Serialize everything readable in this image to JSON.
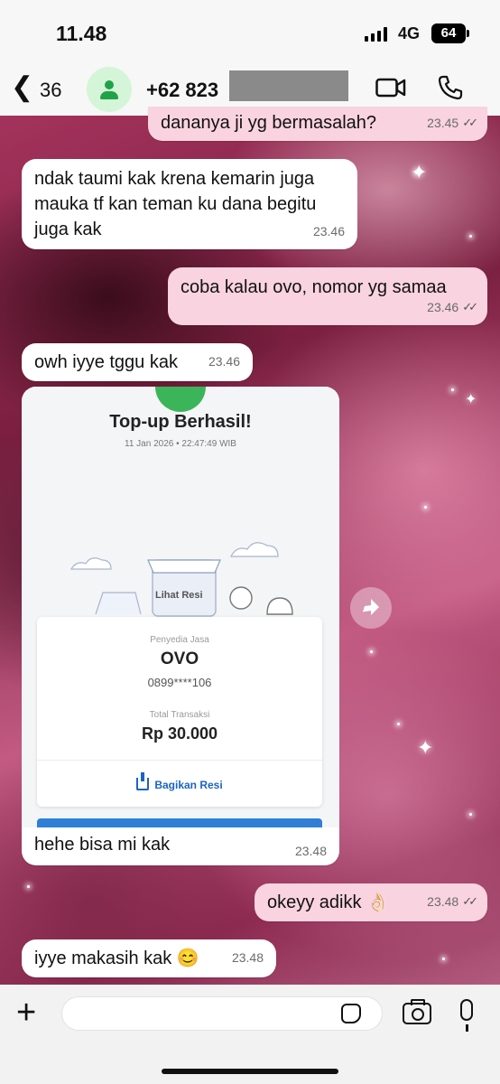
{
  "status_bar": {
    "time": "11.48",
    "network": "4G",
    "battery": "64"
  },
  "header": {
    "back_count": "36",
    "contact": "+62 823",
    "icons": [
      "back-icon",
      "avatar-icon",
      "video-call-icon",
      "voice-call-icon"
    ]
  },
  "messages": [
    {
      "dir": "out",
      "text": "dananya ji yg bermasalah?",
      "time": "23.45",
      "read": true
    },
    {
      "dir": "in",
      "text": "ndak taumi kak krena kemarin juga mauka tf kan teman ku dana begitu juga kak",
      "time": "23.46"
    },
    {
      "dir": "out",
      "text": "coba kalau ovo, nomor yg samaa",
      "time": "23.46",
      "read": true
    },
    {
      "dir": "in",
      "text": "owh iyye tggu kak",
      "time": "23.46"
    },
    {
      "dir": "in",
      "text": "hehe bisa mi kak",
      "time": "23.48"
    },
    {
      "dir": "out",
      "text": "okeyy adikk 👌🏻",
      "time": "23.48",
      "read": true
    },
    {
      "dir": "in",
      "text": "iyye makasih kak 😊",
      "time": "23.48"
    }
  ],
  "receipt": {
    "title": "Top-up Berhasil!",
    "datetime": "11 Jan 2026 • 22:47:49 WIB",
    "view_receipt": "Lihat Resi",
    "provider_label": "Penyedia Jasa",
    "provider": "OVO",
    "number": "0899****106",
    "total_label": "Total Transaksi",
    "amount": "Rp 30.000",
    "share": "Bagikan Resi"
  },
  "input": {
    "placeholder": "",
    "icons": [
      "plus-icon",
      "sticker-icon",
      "camera-icon",
      "mic-icon"
    ]
  },
  "colors": {
    "incoming": "#ffffff",
    "outgoing": "#f9d3df",
    "avatar_bg": "#d5f5d8",
    "avatar_fg": "#20a348"
  }
}
